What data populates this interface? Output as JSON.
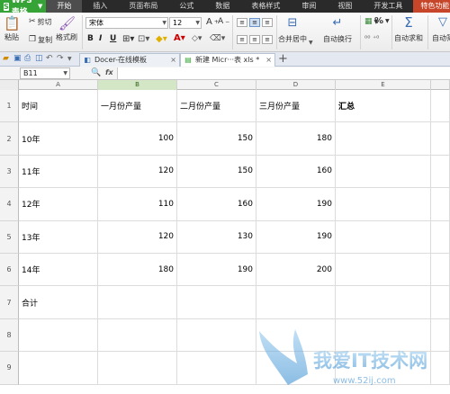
{
  "app": {
    "name": "WPS 表格",
    "logo": "S"
  },
  "menu": [
    "开始",
    "插入",
    "页面布局",
    "公式",
    "数据",
    "表格样式",
    "审阅",
    "视图",
    "开发工具",
    "特色功能"
  ],
  "ribbon": {
    "paste": "粘贴",
    "cut": "剪切",
    "copy": "复制",
    "format_painter": "格式刷",
    "font_name": "宋体",
    "font_size": "12",
    "bold": "B",
    "italic": "I",
    "underline": "U",
    "merge_center": "合并居中",
    "wrap_text": "自动换行",
    "percent": "%",
    "autosum": "自动求和",
    "auto_filter": "自动筛"
  },
  "doc_tabs": [
    {
      "label": "Docer-在线模板",
      "active": false
    },
    {
      "label": "新建 Micr···表 xls *",
      "active": true
    }
  ],
  "formula_bar": {
    "cell_ref": "B11",
    "fx": "fx",
    "value": ""
  },
  "sheet": {
    "columns": [
      "A",
      "B",
      "C",
      "D",
      "E"
    ],
    "selected_column": "B",
    "selected_cell": "B11",
    "rows": [
      {
        "n": "1",
        "cells": [
          "时间",
          "一月份产量",
          "二月份产量",
          "三月份产量",
          "汇总"
        ]
      },
      {
        "n": "2",
        "cells": [
          "10年",
          "100",
          "150",
          "180",
          ""
        ]
      },
      {
        "n": "3",
        "cells": [
          "11年",
          "120",
          "150",
          "160",
          ""
        ]
      },
      {
        "n": "4",
        "cells": [
          "12年",
          "110",
          "160",
          "190",
          ""
        ]
      },
      {
        "n": "5",
        "cells": [
          "13年",
          "120",
          "130",
          "190",
          ""
        ]
      },
      {
        "n": "6",
        "cells": [
          "14年",
          "180",
          "190",
          "200",
          ""
        ]
      },
      {
        "n": "7",
        "cells": [
          "合计",
          "",
          "",
          "",
          ""
        ]
      },
      {
        "n": "8",
        "cells": [
          "",
          "",
          "",
          "",
          ""
        ]
      },
      {
        "n": "9",
        "cells": [
          "",
          "",
          "",
          "",
          ""
        ]
      }
    ]
  },
  "watermark": {
    "title": "我爱IT技术网",
    "url": "www.52ij.com"
  }
}
